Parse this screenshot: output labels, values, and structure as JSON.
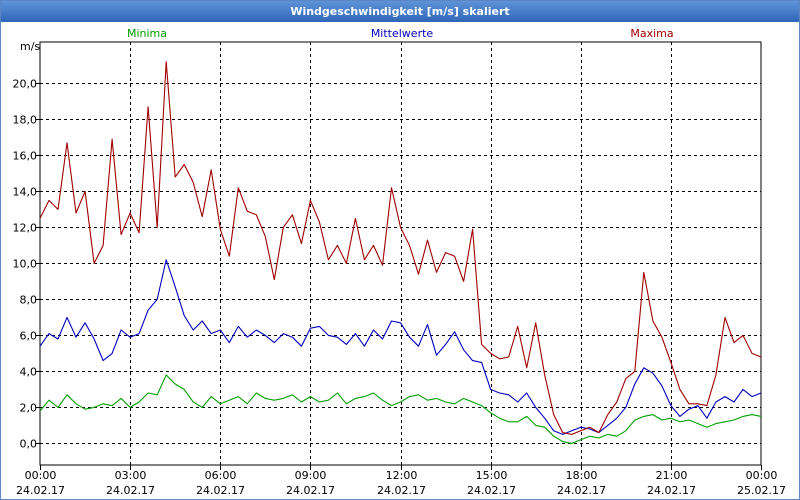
{
  "window": {
    "title": "Windgeschwindigkeit [m/s] skaliert"
  },
  "colors": {
    "minima": "#00a000",
    "mittel": "#0000c0",
    "maxima": "#a00000",
    "grid": "#000000",
    "titlebar": "#3d74c4"
  },
  "chart_data": {
    "type": "line",
    "title": "Windgeschwindigkeit [m/s] skaliert",
    "xlabel": "",
    "ylabel": "m/s",
    "ylim": [
      -1.2,
      22.3
    ],
    "xlim": [
      0,
      24
    ],
    "grid": true,
    "legend_placement": "top",
    "y_ticks": [
      {
        "value": 0,
        "label": "0,0"
      },
      {
        "value": 2,
        "label": "2,0"
      },
      {
        "value": 4,
        "label": "4,0"
      },
      {
        "value": 6,
        "label": "6,0"
      },
      {
        "value": 8,
        "label": "8,0"
      },
      {
        "value": 10,
        "label": "10,0"
      },
      {
        "value": 12,
        "label": "12,0"
      },
      {
        "value": 14,
        "label": "14,0"
      },
      {
        "value": 16,
        "label": "16,0"
      },
      {
        "value": 18,
        "label": "18,0"
      },
      {
        "value": 20,
        "label": "20,0"
      }
    ],
    "x_ticks": [
      {
        "value": 0,
        "time": "00:00",
        "date": "24.02.17"
      },
      {
        "value": 3,
        "time": "03:00",
        "date": "24.02.17"
      },
      {
        "value": 6,
        "time": "06:00",
        "date": "24.02.17"
      },
      {
        "value": 9,
        "time": "09:00",
        "date": "24.02.17"
      },
      {
        "value": 12,
        "time": "12:00",
        "date": "24.02.17"
      },
      {
        "value": 15,
        "time": "15:00",
        "date": "24.02.17"
      },
      {
        "value": 18,
        "time": "18:00",
        "date": "24.02.17"
      },
      {
        "value": 21,
        "time": "21:00",
        "date": "24.02.17"
      },
      {
        "value": 24,
        "time": "00:00",
        "date": "25.02.17"
      }
    ],
    "series": [
      {
        "name": "Minima",
        "color": "#00a000",
        "x": [
          0,
          0.3,
          0.6,
          0.9,
          1.2,
          1.5,
          1.8,
          2.1,
          2.4,
          2.7,
          3,
          3.3,
          3.6,
          3.9,
          4.2,
          4.5,
          4.8,
          5.1,
          5.4,
          5.7,
          6,
          6.3,
          6.6,
          6.9,
          7.2,
          7.5,
          7.8,
          8.1,
          8.4,
          8.7,
          9,
          9.3,
          9.6,
          9.9,
          10.2,
          10.5,
          10.8,
          11.1,
          11.4,
          11.7,
          12,
          12.3,
          12.6,
          12.9,
          13.2,
          13.5,
          13.8,
          14.1,
          14.4,
          14.7,
          15,
          15.3,
          15.6,
          15.9,
          16.2,
          16.5,
          16.8,
          17.1,
          17.4,
          17.7,
          18,
          18.3,
          18.6,
          18.9,
          19.2,
          19.5,
          19.8,
          20.1,
          20.4,
          20.7,
          21,
          21.3,
          21.6,
          21.9,
          22.2,
          22.5,
          22.8,
          23.1,
          23.4,
          23.7,
          24
        ],
        "y": [
          1.8,
          2.4,
          2.0,
          2.7,
          2.2,
          1.9,
          2.0,
          2.2,
          2.1,
          2.5,
          2.0,
          2.3,
          2.8,
          2.7,
          3.8,
          3.3,
          3.0,
          2.3,
          2.0,
          2.6,
          2.2,
          2.4,
          2.6,
          2.2,
          2.8,
          2.5,
          2.4,
          2.5,
          2.7,
          2.3,
          2.6,
          2.3,
          2.4,
          2.8,
          2.2,
          2.5,
          2.6,
          2.8,
          2.4,
          2.1,
          2.3,
          2.6,
          2.7,
          2.4,
          2.5,
          2.3,
          2.2,
          2.5,
          2.3,
          2.1,
          1.7,
          1.4,
          1.2,
          1.2,
          1.5,
          1.0,
          0.9,
          0.4,
          0.1,
          0.0,
          0.2,
          0.4,
          0.3,
          0.5,
          0.4,
          0.7,
          1.3,
          1.5,
          1.6,
          1.3,
          1.4,
          1.2,
          1.3,
          1.1,
          0.9,
          1.1,
          1.2,
          1.3,
          1.5,
          1.6,
          1.5
        ]
      },
      {
        "name": "Mittelwerte",
        "color": "#0000c0",
        "x": [
          0,
          0.3,
          0.6,
          0.9,
          1.2,
          1.5,
          1.8,
          2.1,
          2.4,
          2.7,
          3,
          3.3,
          3.6,
          3.9,
          4.2,
          4.5,
          4.8,
          5.1,
          5.4,
          5.7,
          6,
          6.3,
          6.6,
          6.9,
          7.2,
          7.5,
          7.8,
          8.1,
          8.4,
          8.7,
          9,
          9.3,
          9.6,
          9.9,
          10.2,
          10.5,
          10.8,
          11.1,
          11.4,
          11.7,
          12,
          12.3,
          12.6,
          12.9,
          13.2,
          13.5,
          13.8,
          14.1,
          14.4,
          14.7,
          15,
          15.3,
          15.6,
          15.9,
          16.2,
          16.5,
          16.8,
          17.1,
          17.4,
          17.7,
          18,
          18.3,
          18.6,
          18.9,
          19.2,
          19.5,
          19.8,
          20.1,
          20.4,
          20.7,
          21,
          21.3,
          21.6,
          21.9,
          22.2,
          22.5,
          22.8,
          23.1,
          23.4,
          23.7,
          24
        ],
        "y": [
          5.4,
          6.1,
          5.8,
          7.0,
          5.9,
          6.7,
          5.8,
          4.6,
          5.0,
          6.3,
          5.9,
          6.1,
          7.4,
          8.0,
          10.2,
          8.7,
          7.1,
          6.3,
          6.8,
          6.1,
          6.3,
          5.6,
          6.5,
          5.9,
          6.3,
          6.0,
          5.6,
          6.1,
          5.9,
          5.4,
          6.4,
          6.5,
          6.0,
          5.9,
          5.5,
          6.1,
          5.4,
          6.3,
          5.8,
          6.8,
          6.7,
          5.9,
          5.4,
          6.6,
          4.9,
          5.5,
          6.2,
          5.2,
          4.6,
          4.5,
          3.0,
          2.8,
          2.7,
          2.3,
          2.8,
          2.0,
          1.4,
          0.7,
          0.5,
          0.7,
          0.9,
          0.8,
          0.6,
          1.0,
          1.4,
          2.0,
          3.3,
          4.2,
          3.9,
          3.2,
          2.1,
          1.5,
          1.9,
          2.1,
          1.4,
          2.3,
          2.6,
          2.3,
          3.0,
          2.6,
          2.8
        ]
      },
      {
        "name": "Maxima",
        "color": "#a00000",
        "x": [
          0,
          0.3,
          0.6,
          0.9,
          1.2,
          1.5,
          1.8,
          2.1,
          2.4,
          2.7,
          3,
          3.3,
          3.6,
          3.9,
          4.2,
          4.5,
          4.8,
          5.1,
          5.4,
          5.7,
          6,
          6.3,
          6.6,
          6.9,
          7.2,
          7.5,
          7.8,
          8.1,
          8.4,
          8.7,
          9,
          9.3,
          9.6,
          9.9,
          10.2,
          10.5,
          10.8,
          11.1,
          11.4,
          11.7,
          12,
          12.3,
          12.6,
          12.9,
          13.2,
          13.5,
          13.8,
          14.1,
          14.4,
          14.7,
          15,
          15.3,
          15.6,
          15.9,
          16.2,
          16.5,
          16.8,
          17.1,
          17.4,
          17.7,
          18,
          18.3,
          18.6,
          18.9,
          19.2,
          19.5,
          19.8,
          20.1,
          20.4,
          20.7,
          21,
          21.3,
          21.6,
          21.9,
          22.2,
          22.5,
          22.8,
          23.1,
          23.4,
          23.7,
          24
        ],
        "y": [
          12.5,
          13.5,
          13.0,
          16.7,
          12.8,
          14.0,
          10.0,
          11.0,
          16.9,
          11.6,
          12.8,
          11.7,
          18.7,
          12.0,
          21.2,
          14.8,
          15.5,
          14.5,
          12.6,
          15.2,
          11.9,
          10.4,
          14.2,
          12.9,
          12.7,
          11.5,
          9.1,
          12.0,
          12.7,
          11.1,
          13.5,
          12.3,
          10.2,
          11.0,
          10.0,
          12.5,
          10.2,
          11.0,
          9.9,
          14.2,
          12.0,
          11.0,
          9.4,
          11.3,
          9.5,
          10.6,
          10.4,
          9.0,
          11.9,
          5.5,
          5.0,
          4.7,
          4.8,
          6.5,
          4.2,
          6.7,
          3.8,
          1.6,
          0.6,
          0.5,
          0.7,
          0.9,
          0.6,
          1.6,
          2.3,
          3.6,
          4.0,
          9.5,
          6.8,
          5.9,
          4.5,
          3.0,
          2.2,
          2.2,
          2.1,
          3.8,
          7.0,
          5.6,
          6.0,
          5.0,
          4.8
        ]
      }
    ]
  }
}
